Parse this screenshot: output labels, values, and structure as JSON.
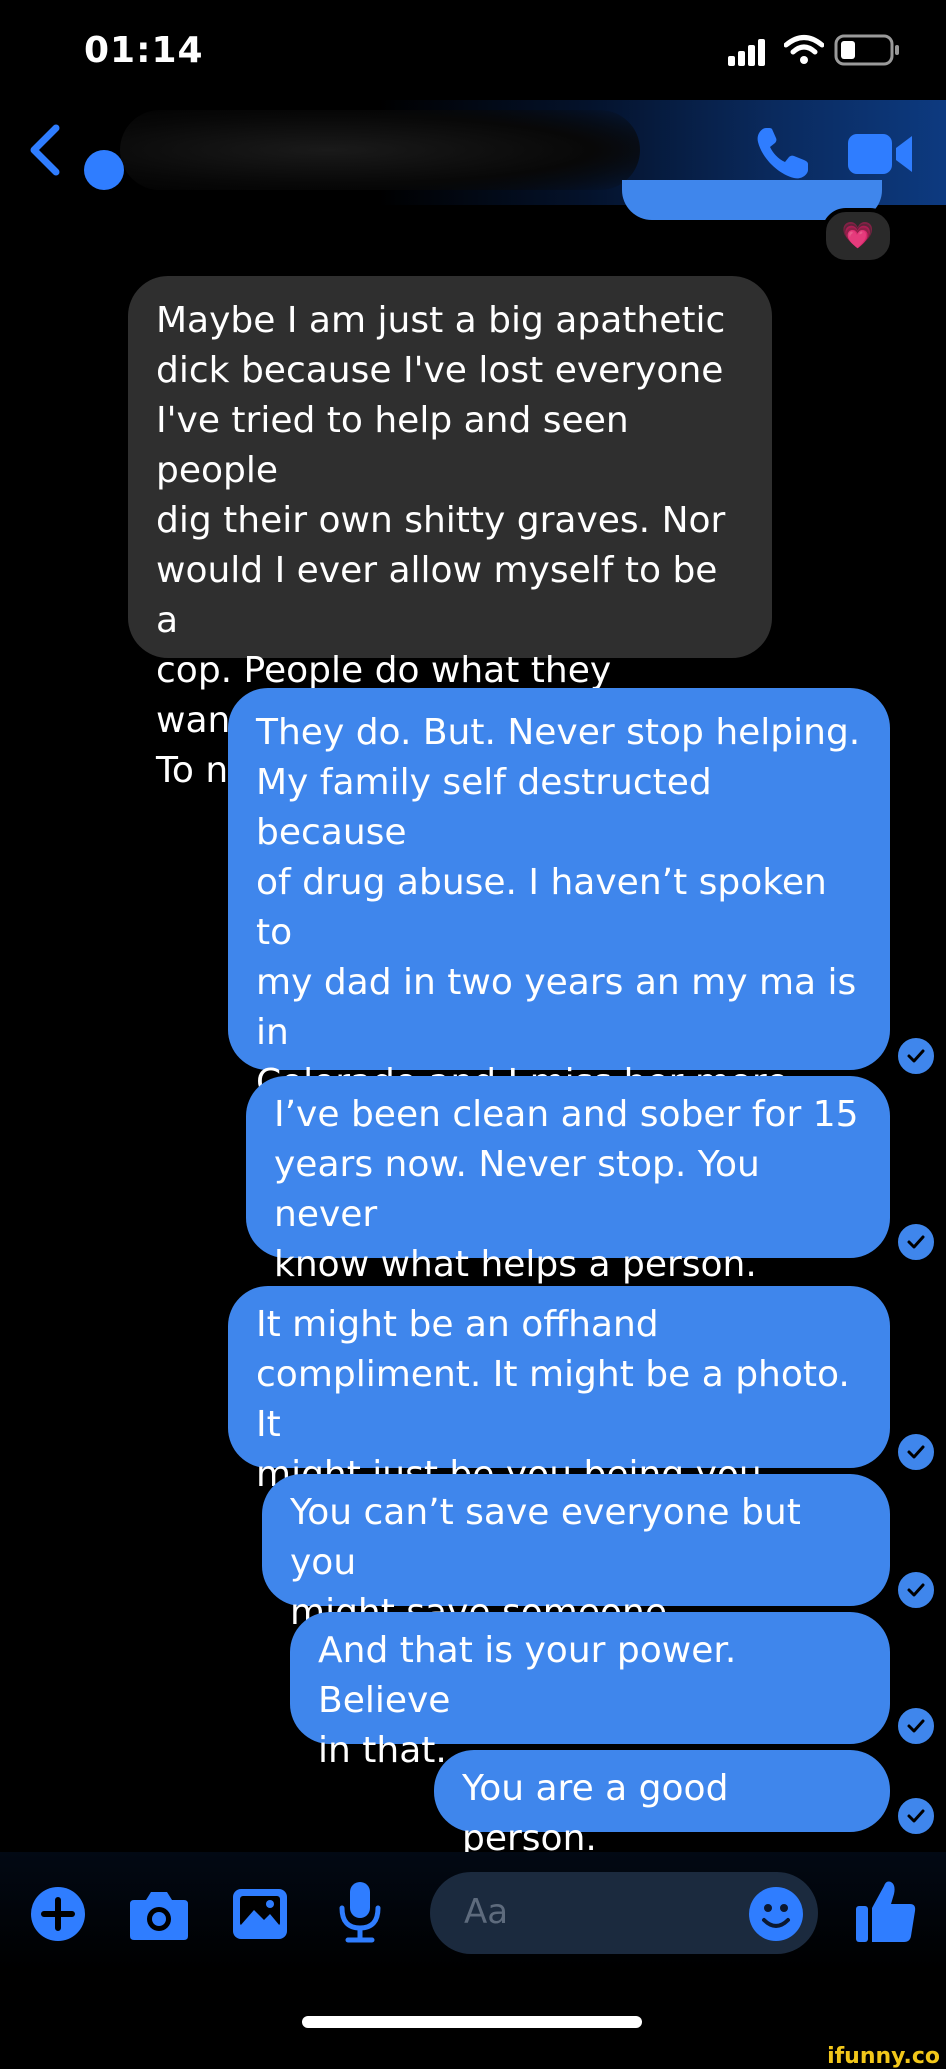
{
  "status_bar": {
    "time": "01:14"
  },
  "header": {
    "back_icon": "chevron-left-icon",
    "call_icon": "phone-icon",
    "video_icon": "video-camera-icon"
  },
  "reaction": {
    "emoji": "💗"
  },
  "messages": [
    {
      "from": "other",
      "text": "Maybe I am just a big apathetic\ndick because I've lost everyone\nI've tried to help and seen people\ndig their own shitty graves. Nor\nwould I ever allow myself to be a\ncop. People do what they wanna.\nTo no end except death."
    },
    {
      "from": "me",
      "text": "They do. But. Never stop helping.\nMy family self destructed because\nof drug abuse. I haven’t spoken to\nmy dad in two years an my ma is in\nColorado and I miss her more than\nanything. I will never ever stop\ntrying to heal that wound."
    },
    {
      "from": "me",
      "text": "I’ve been clean and sober for 15\nyears now. Never stop. You never\nknow what helps a person."
    },
    {
      "from": "me",
      "text": "It might be an offhand\ncompliment. It might be a photo. It\nmight just be you being you."
    },
    {
      "from": "me",
      "text": "You can’t save everyone but you\nmight save someone."
    },
    {
      "from": "me",
      "text": "And that is your power. Believe\nin that."
    },
    {
      "from": "me",
      "text": "You are a good person."
    }
  ],
  "composer": {
    "placeholder": "Aa"
  },
  "watermark": "ifunny.co",
  "colors": {
    "sent_bubble": "#3f86ec",
    "received_bubble": "#2f2f2f",
    "accent": "#2f7dff"
  }
}
